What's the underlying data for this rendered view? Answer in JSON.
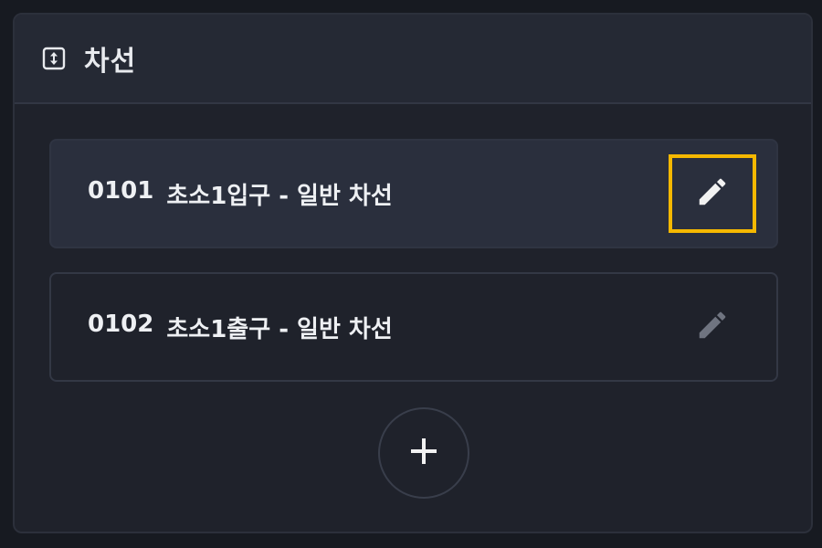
{
  "panel": {
    "title": "차선",
    "icon": "swap-vertical-box-icon"
  },
  "lanes": [
    {
      "code": "0101",
      "name": "초소1입구 - 일반 차선",
      "selected": true,
      "edit_icon": "pencil-icon"
    },
    {
      "code": "0102",
      "name": "초소1출구 - 일반 차선",
      "selected": false,
      "edit_icon": "pencil-icon"
    }
  ],
  "add_button": {
    "icon": "plus-icon"
  },
  "colors": {
    "highlight": "#f5b800",
    "text": "#eef0f3",
    "pencil_active": "#f2f2f2",
    "pencil_inactive": "#6f7480"
  }
}
